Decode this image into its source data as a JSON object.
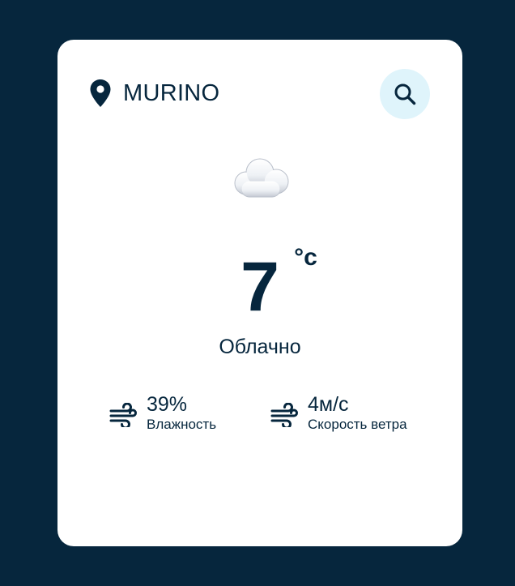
{
  "location": {
    "icon": "map-pin-icon",
    "city": "MURINO"
  },
  "search": {
    "icon": "search-icon",
    "button_color": "#dff4fb"
  },
  "weather": {
    "icon": "cloud-icon",
    "temperature": "7",
    "unit": "°c",
    "condition": "Облачно"
  },
  "stats": {
    "humidity": {
      "icon": "wind-icon",
      "value": "39%",
      "label": "Влажность"
    },
    "wind": {
      "icon": "wind-icon",
      "value": "4м/с",
      "label": "Скорость ветра"
    }
  },
  "colors": {
    "background": "#06263d",
    "card": "#ffffff",
    "text": "#06263d",
    "accent": "#dff4fb"
  }
}
